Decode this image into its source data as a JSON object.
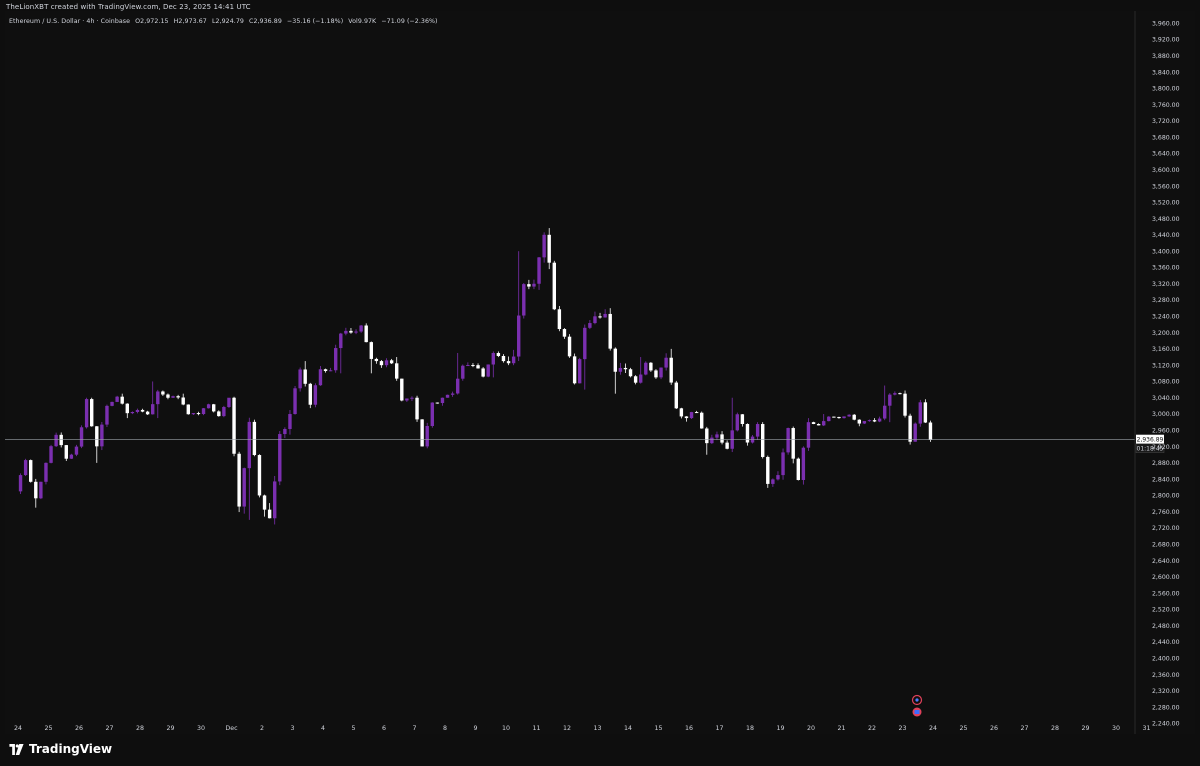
{
  "attribution": "TheLionXBT created with TradingView.com, Dec 23, 2025 14:41 UTC",
  "legend": {
    "symbol": "Ethereum / U.S. Dollar · 4h · Coinbase",
    "open": "O2,972.15",
    "high": "H2,973.67",
    "low": "L2,924.79",
    "close": "C2,936.89",
    "change": "−35.16 (−1.18%)",
    "volume": "Vol9.97K",
    "volume_change": "−71.09 (−2.36%)"
  },
  "brand": "TradingView",
  "colors": {
    "background": "#0f0f0f",
    "up_candle": "#7b2fb0",
    "down_candle": "#ffffff",
    "price_line": "#9aa0a6",
    "axis_text": "#d1d4dc"
  },
  "icons": [
    "tradingview-logo-icon",
    "dividends-icon",
    "earnings-icon"
  ],
  "chart_data": {
    "type": "candlestick",
    "interval": "4h",
    "x_axis_labels": [
      "24",
      "25",
      "26",
      "27",
      "28",
      "29",
      "30",
      "Dec",
      "2",
      "3",
      "4",
      "5",
      "6",
      "7",
      "8",
      "9",
      "10",
      "11",
      "12",
      "13",
      "14",
      "15",
      "16",
      "17",
      "18",
      "19",
      "20",
      "21",
      "22",
      "23",
      "24",
      "25",
      "26",
      "27",
      "28",
      "29",
      "30",
      "31"
    ],
    "y_axis_labels": [
      "3,960.00",
      "3,920.00",
      "3,880.00",
      "3,840.00",
      "3,800.00",
      "3,760.00",
      "3,720.00",
      "3,680.00",
      "3,640.00",
      "3,600.00",
      "3,560.00",
      "3,520.00",
      "3,480.00",
      "3,440.00",
      "3,400.00",
      "3,360.00",
      "3,320.00",
      "3,280.00",
      "3,240.00",
      "3,200.00",
      "3,160.00",
      "3,120.00",
      "3,080.00",
      "3,040.00",
      "3,000.00",
      "2,960.00",
      "2,920.00",
      "2,880.00",
      "2,840.00",
      "2,800.00",
      "2,760.00",
      "2,720.00",
      "2,680.00",
      "2,640.00",
      "2,600.00",
      "2,560.00",
      "2,520.00",
      "2,480.00",
      "2,440.00",
      "2,400.00",
      "2,360.00",
      "2,320.00",
      "2,280.00",
      "2,240.00"
    ],
    "ylim": [
      2214,
      3990
    ],
    "last_price_label": "2,936.89",
    "countdown_label": "01:18:45",
    "grid": false,
    "approx_daily_ohlc": [
      {
        "date": "Nov 24",
        "open": 2810,
        "high": 2890,
        "low": 2770,
        "close": 2880
      },
      {
        "date": "Nov 25",
        "open": 2880,
        "high": 2960,
        "low": 2860,
        "close": 2920
      },
      {
        "date": "Nov 26",
        "open": 2920,
        "high": 3040,
        "low": 2880,
        "close": 3020
      },
      {
        "date": "Nov 27",
        "open": 3020,
        "high": 3050,
        "low": 2990,
        "close": 3010
      },
      {
        "date": "Nov 28",
        "open": 3010,
        "high": 3080,
        "low": 2990,
        "close": 3040
      },
      {
        "date": "Nov 29",
        "open": 3040,
        "high": 3050,
        "low": 2980,
        "close": 3000
      },
      {
        "date": "Nov 30",
        "open": 3000,
        "high": 3030,
        "low": 2980,
        "close": 3040
      },
      {
        "date": "Dec 1",
        "open": 3040,
        "high": 3050,
        "low": 2740,
        "close": 2800
      },
      {
        "date": "Dec 2",
        "open": 2800,
        "high": 3010,
        "low": 2720,
        "close": 3000
      },
      {
        "date": "Dec 3",
        "open": 3000,
        "high": 3130,
        "low": 2980,
        "close": 3110
      },
      {
        "date": "Dec 4",
        "open": 3110,
        "high": 3240,
        "low": 3100,
        "close": 3200
      },
      {
        "date": "Dec 5",
        "open": 3200,
        "high": 3230,
        "low": 3100,
        "close": 3120
      },
      {
        "date": "Dec 6",
        "open": 3120,
        "high": 3140,
        "low": 3000,
        "close": 3040
      },
      {
        "date": "Dec 7",
        "open": 3040,
        "high": 3060,
        "low": 2910,
        "close": 3040
      },
      {
        "date": "Dec 8",
        "open": 3040,
        "high": 3150,
        "low": 3040,
        "close": 3120
      },
      {
        "date": "Dec 9",
        "open": 3120,
        "high": 3170,
        "low": 3090,
        "close": 3130
      },
      {
        "date": "Dec 10",
        "open": 3130,
        "high": 3400,
        "low": 3120,
        "close": 3320
      },
      {
        "date": "Dec 11",
        "open": 3320,
        "high": 3480,
        "low": 3180,
        "close": 3190
      },
      {
        "date": "Dec 12",
        "open": 3190,
        "high": 3260,
        "low": 3060,
        "close": 3240
      },
      {
        "date": "Dec 13",
        "open": 3240,
        "high": 3260,
        "low": 3050,
        "close": 3110
      },
      {
        "date": "Dec 14",
        "open": 3110,
        "high": 3140,
        "low": 3070,
        "close": 3090
      },
      {
        "date": "Dec 15",
        "open": 3090,
        "high": 3160,
        "low": 2970,
        "close": 2990
      },
      {
        "date": "Dec 16",
        "open": 2990,
        "high": 3020,
        "low": 2900,
        "close": 2950
      },
      {
        "date": "Dec 17",
        "open": 2950,
        "high": 3040,
        "low": 2900,
        "close": 2930
      },
      {
        "date": "Dec 18",
        "open": 2930,
        "high": 2980,
        "low": 2790,
        "close": 2850
      },
      {
        "date": "Dec 19",
        "open": 2850,
        "high": 2990,
        "low": 2780,
        "close": 2980
      },
      {
        "date": "Dec 20",
        "open": 2980,
        "high": 3000,
        "low": 2970,
        "close": 2990
      },
      {
        "date": "Dec 21",
        "open": 2990,
        "high": 3000,
        "low": 2970,
        "close": 2985
      },
      {
        "date": "Dec 22",
        "open": 2985,
        "high": 3070,
        "low": 2980,
        "close": 3050
      },
      {
        "date": "Dec 23",
        "open": 3050,
        "high": 3060,
        "low": 2925,
        "close": 2937
      }
    ]
  }
}
